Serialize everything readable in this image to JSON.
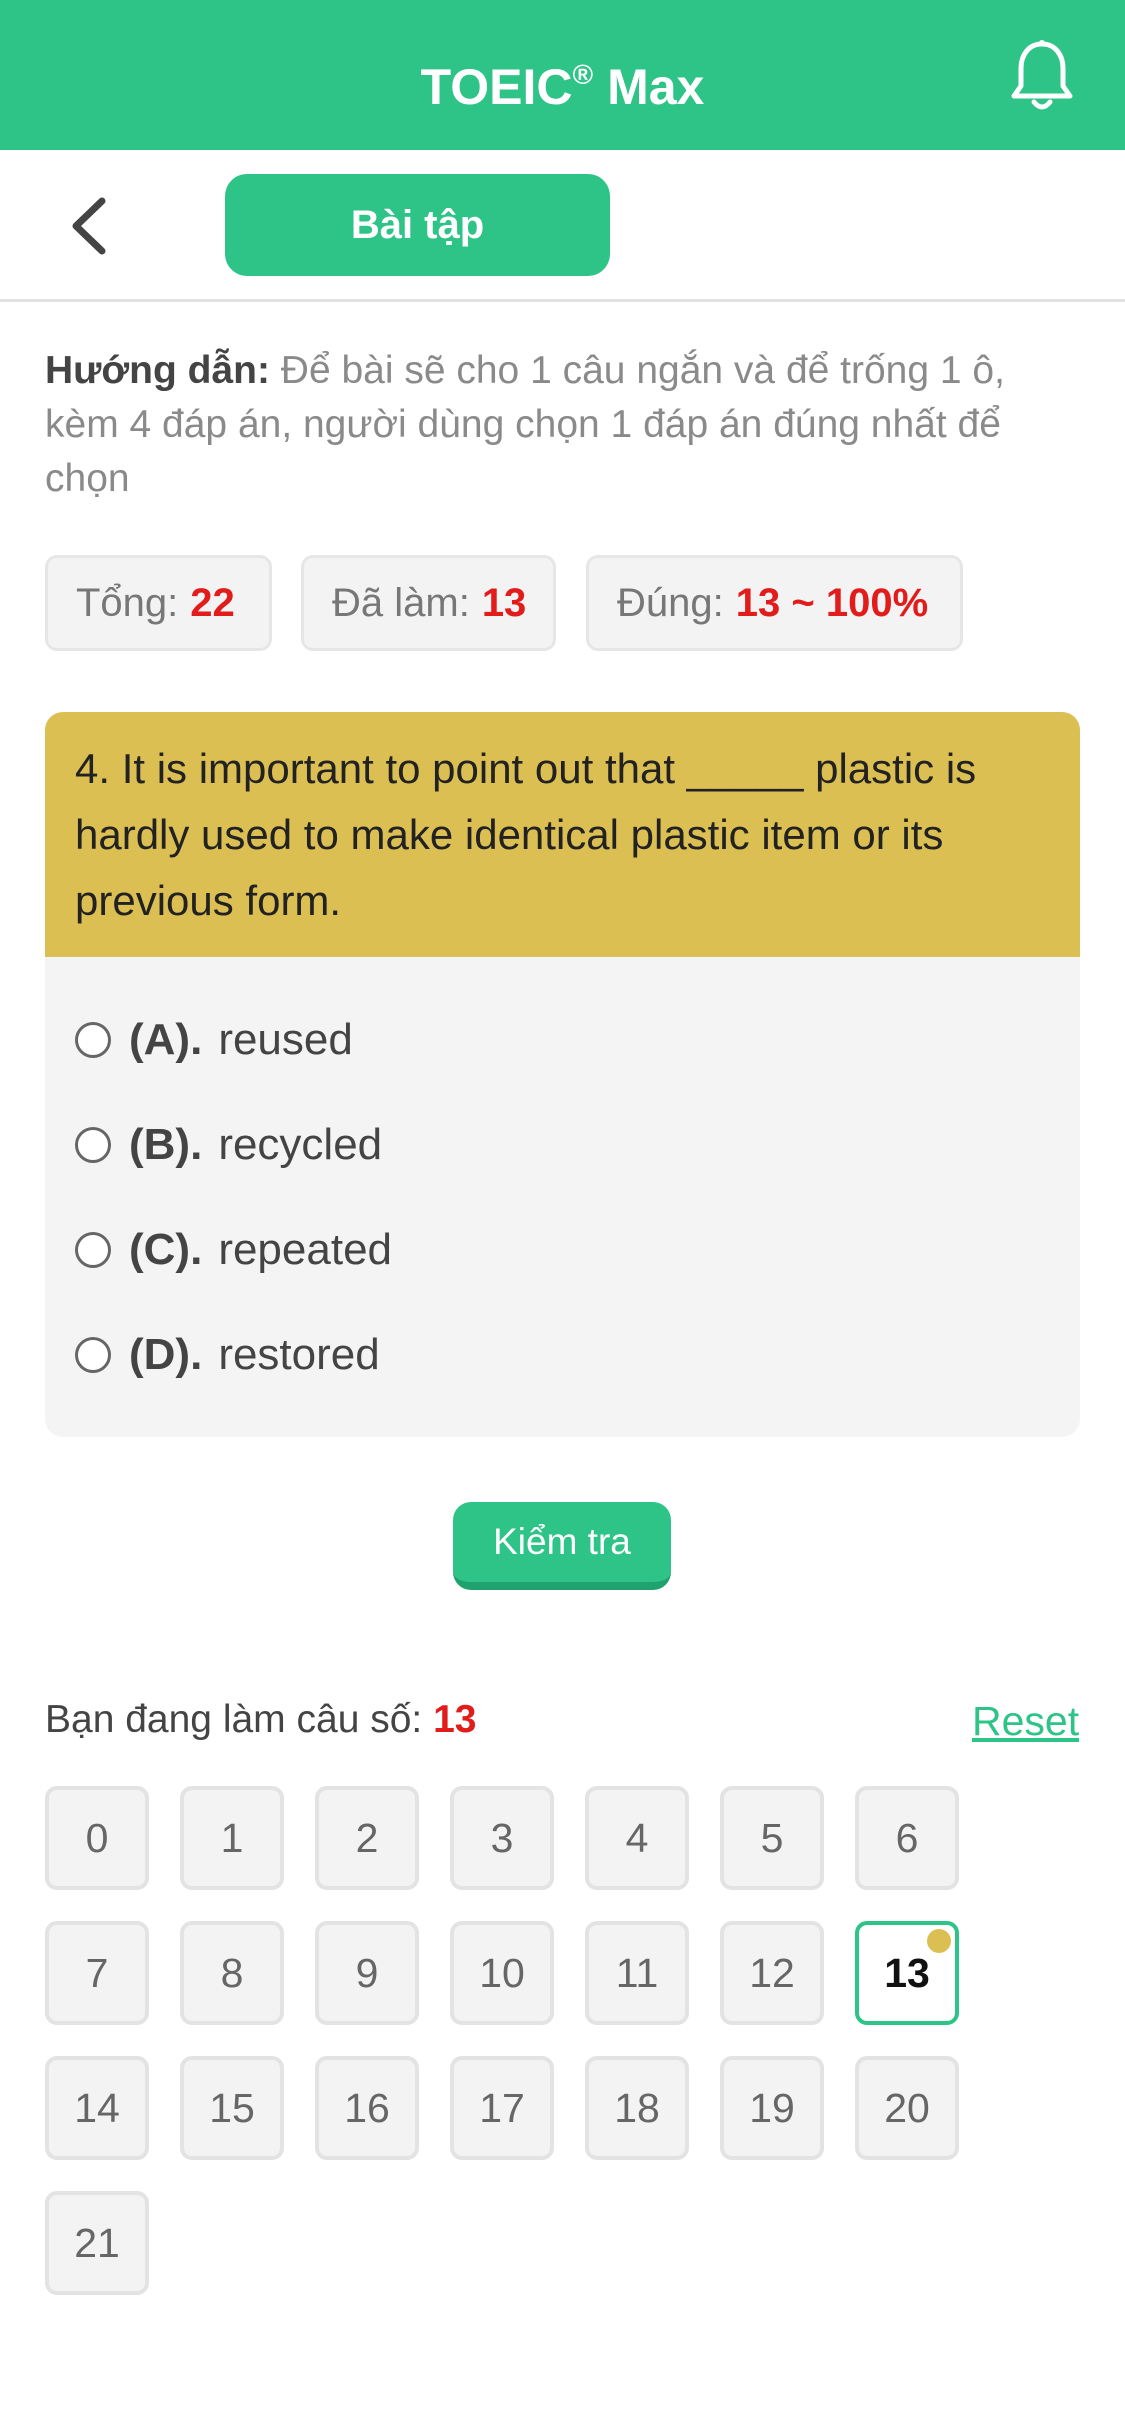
{
  "header": {
    "title": "TOEIC",
    "title_mark": "®",
    "title_suffix": " Max",
    "accent_color": "#2ec487"
  },
  "subbar": {
    "tab_label": "Bài tập"
  },
  "guide": {
    "label": "Hướng dẫn:",
    "text": " Để bài sẽ cho 1 câu ngắn và để trống 1 ô, kèm 4 đáp án, người dùng chọn 1 đáp án đúng nhất để chọn"
  },
  "stats": {
    "total_label": "Tổng:",
    "total_value": "22",
    "done_label": "Đã làm:",
    "done_value": "13",
    "correct_label": "Đúng:",
    "correct_value": "13 ~ 100%"
  },
  "question": {
    "text": "4. It is important to point out that _____ plastic is hardly used to make identical plastic item or its previous form.",
    "options": [
      {
        "letter": "(A).",
        "text": "reused"
      },
      {
        "letter": "(B).",
        "text": "recycled"
      },
      {
        "letter": "(C).",
        "text": "repeated"
      },
      {
        "letter": "(D).",
        "text": "restored"
      }
    ]
  },
  "check_button_label": "Kiểm tra",
  "progress": {
    "label": "Bạn đang làm câu số: ",
    "current": "13",
    "reset_label": "Reset"
  },
  "numbers": [
    "0",
    "1",
    "2",
    "3",
    "4",
    "5",
    "6",
    "7",
    "8",
    "9",
    "10",
    "11",
    "12",
    "13",
    "14",
    "15",
    "16",
    "17",
    "18",
    "19",
    "20",
    "21"
  ],
  "current_index": 13
}
